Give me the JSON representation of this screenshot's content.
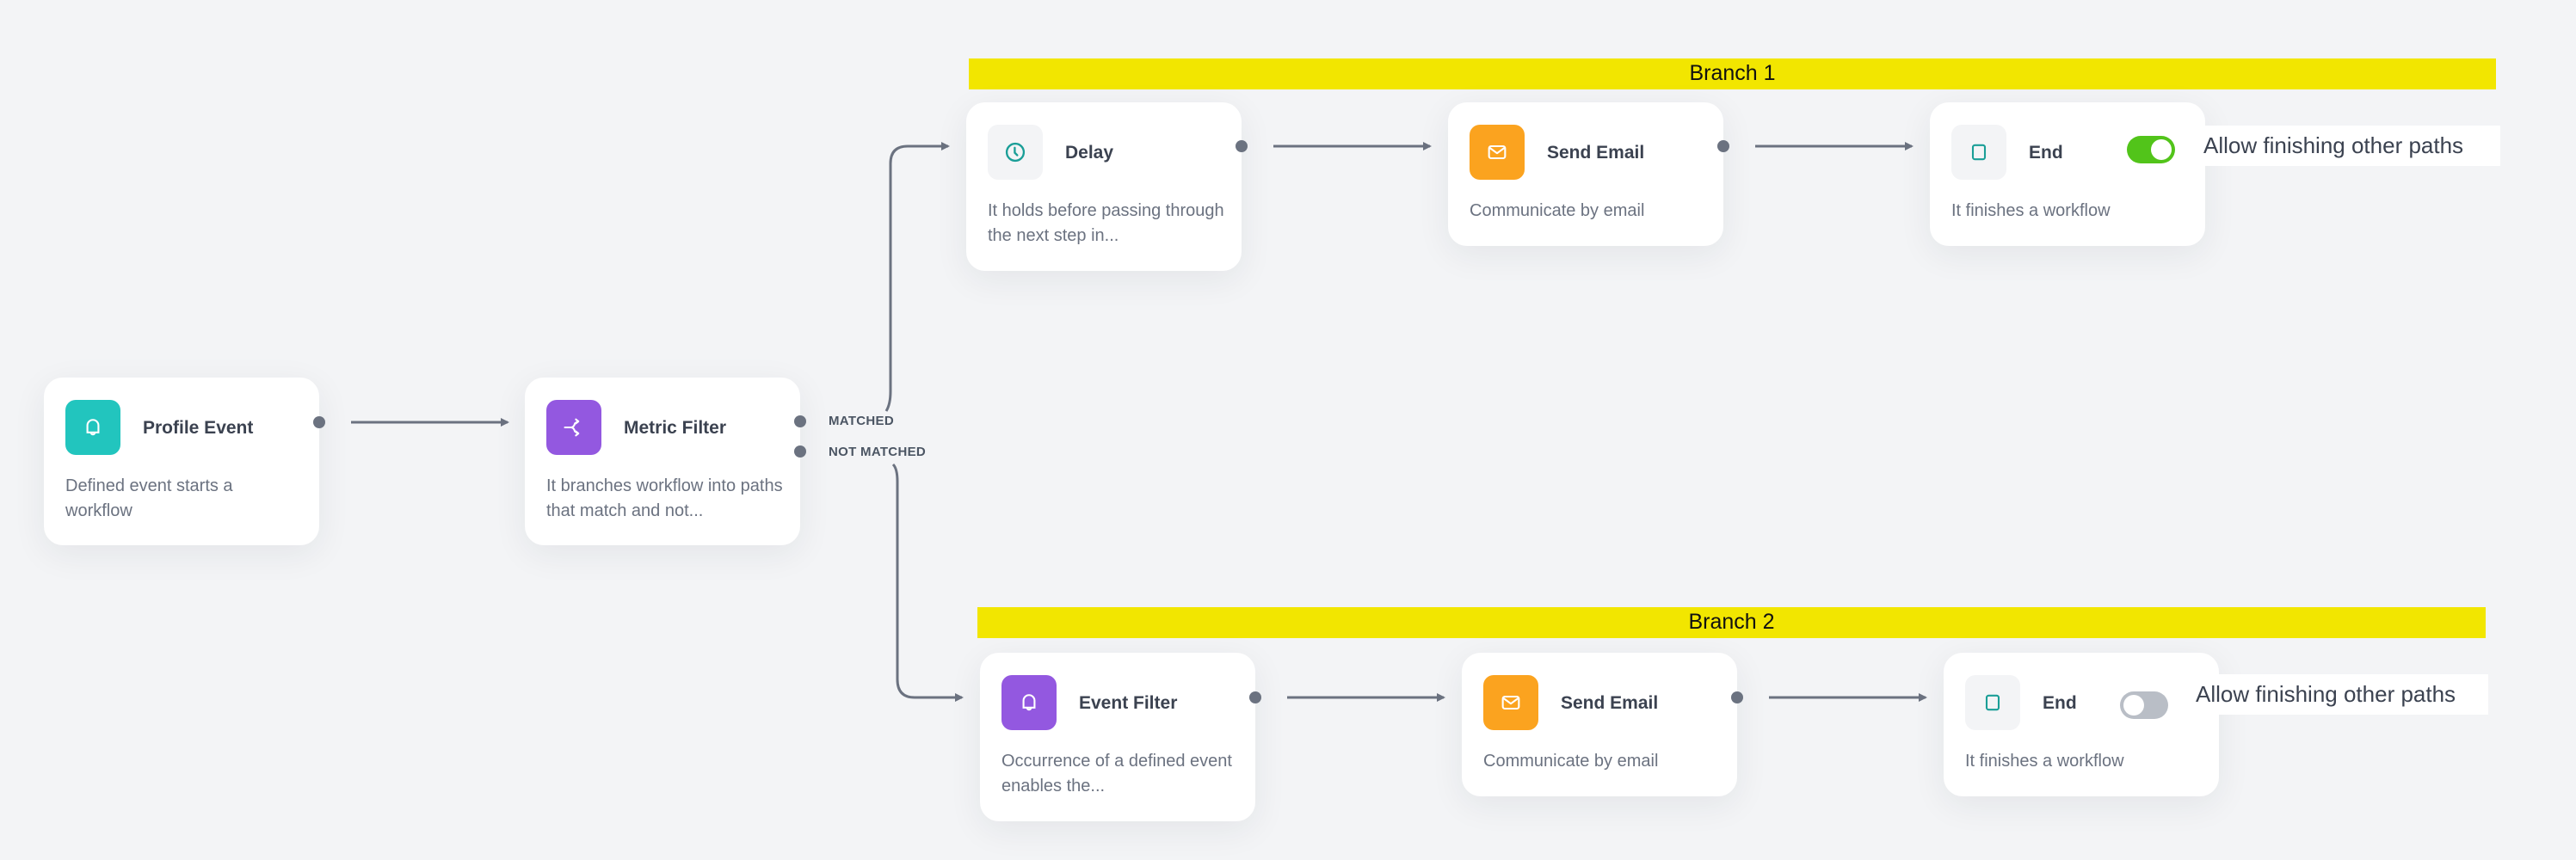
{
  "canvas": {
    "background": "#f3f4f6"
  },
  "branches": [
    {
      "label": "Branch 1",
      "color": "#f2e600"
    },
    {
      "label": "Branch 2",
      "color": "#f2e600"
    }
  ],
  "nodes": {
    "profile_event": {
      "title": "Profile Event",
      "description": "Defined event starts a workflow",
      "icon": "bell-icon",
      "icon_bg": "#22c5be"
    },
    "metric_filter": {
      "title": "Metric Filter",
      "description": "It branches workflow into paths that match and not...",
      "icon": "split-arrows-icon",
      "icon_bg": "#9358e0",
      "ports": [
        {
          "label": "MATCHED"
        },
        {
          "label": "NOT MATCHED"
        }
      ]
    },
    "delay": {
      "title": "Delay",
      "description": "It holds before passing through the next step in...",
      "icon": "clock-icon",
      "icon_bg": "#f3f4f6"
    },
    "send_email_1": {
      "title": "Send Email",
      "description": "Communicate by email",
      "icon": "envelope-icon",
      "icon_bg": "#fba31f"
    },
    "end_1": {
      "title": "End",
      "description": "It finishes a workflow",
      "icon": "square-icon",
      "icon_bg": "#f3f4f6",
      "toggle": {
        "label": "Allow finishing other paths",
        "on": true,
        "on_color": "#52c41a"
      }
    },
    "event_filter": {
      "title": "Event Filter",
      "description": "Occurrence of a defined event enables the...",
      "icon": "bell-icon",
      "icon_bg": "#9358e0"
    },
    "send_email_2": {
      "title": "Send Email",
      "description": "Communicate by email",
      "icon": "envelope-icon",
      "icon_bg": "#fba31f"
    },
    "end_2": {
      "title": "End",
      "description": "It finishes a workflow",
      "icon": "square-icon",
      "icon_bg": "#f3f4f6",
      "toggle": {
        "label": "Allow finishing other paths",
        "on": false,
        "off_color": "#b9bec6"
      }
    }
  }
}
